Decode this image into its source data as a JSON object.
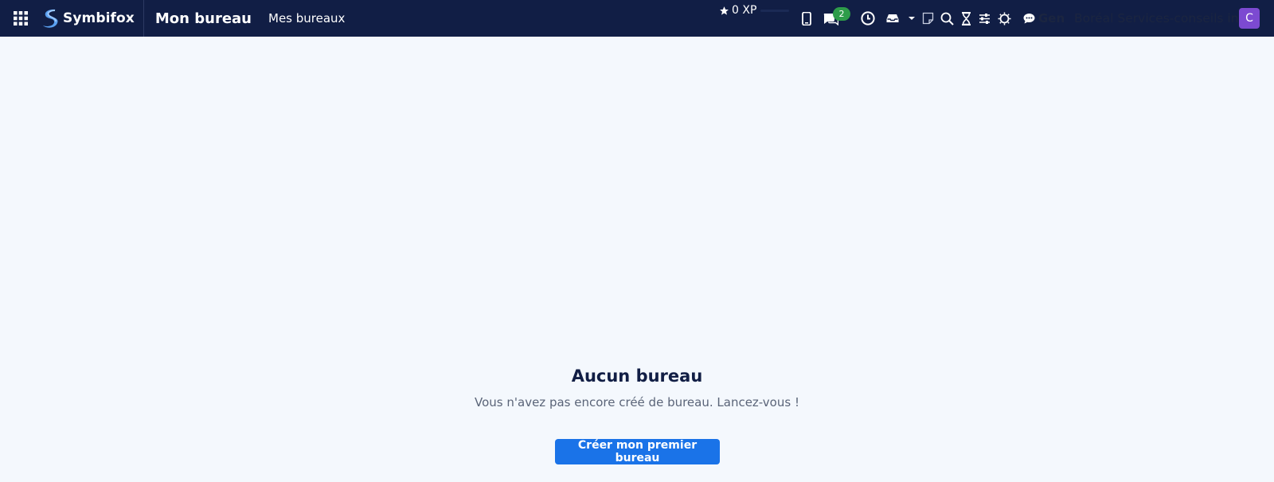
{
  "navbar": {
    "apps_icon": "grid-apps-icon",
    "brand": "Symbifox",
    "app_title": "Mon bureau",
    "menu": [
      "Mes bureaux"
    ],
    "xp_label": "0 XP",
    "messages_badge": "2",
    "gen_label": "Gen",
    "company": "Boréal Services-conseils inc.",
    "avatar_initial": "C",
    "systray_icons": [
      "mobile-icon",
      "chat-icon",
      "clock-icon",
      "inbox-icon",
      "caret-icon",
      "note-icon",
      "search-icon",
      "hourglass-icon",
      "sliders-icon",
      "sun-icon",
      "chat-bubble-icon"
    ]
  },
  "empty_state": {
    "title": "Aucun bureau",
    "subtitle": "Vous n'avez pas encore créé de bureau. Lancez-vous !",
    "cta_label": "Créer mon premier bureau"
  },
  "colors": {
    "navbar": "#111e45",
    "page_background": "#f4f8fd",
    "primary": "#1a73e8",
    "badge": "#2e9c4a",
    "avatar": "#7c4ad1"
  }
}
